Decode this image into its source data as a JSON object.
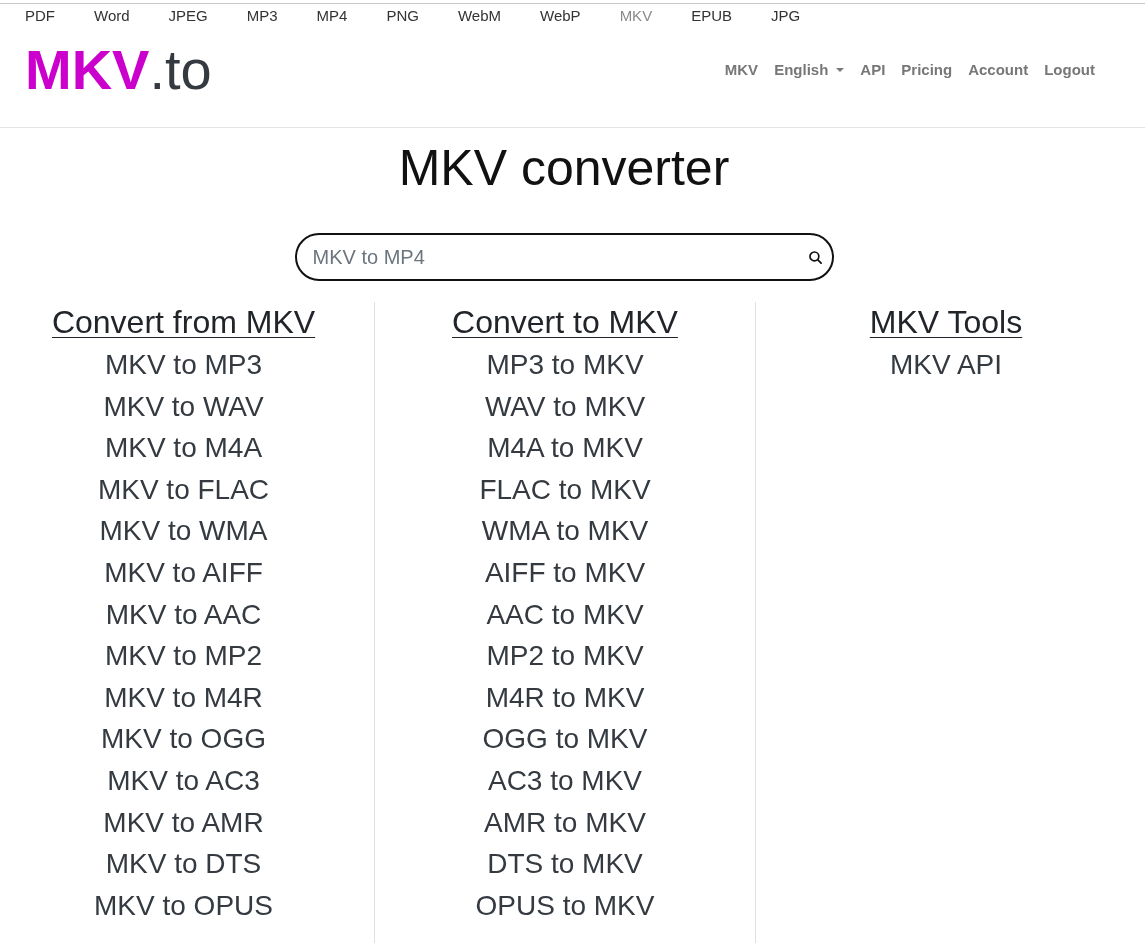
{
  "top_bar": {
    "links": [
      {
        "label": "PDF",
        "selected": false
      },
      {
        "label": "Word",
        "selected": false
      },
      {
        "label": "JPEG",
        "selected": false
      },
      {
        "label": "MP3",
        "selected": false
      },
      {
        "label": "MP4",
        "selected": false
      },
      {
        "label": "PNG",
        "selected": false
      },
      {
        "label": "WebM",
        "selected": false
      },
      {
        "label": "WebP",
        "selected": false
      },
      {
        "label": "MKV",
        "selected": true
      },
      {
        "label": "EPUB",
        "selected": false
      },
      {
        "label": "JPG",
        "selected": false
      }
    ]
  },
  "header": {
    "logo": {
      "brand": "MKV",
      "suffix": ".to"
    },
    "nav": [
      {
        "label": "MKV",
        "kind": "link"
      },
      {
        "label": "English",
        "kind": "dropdown"
      },
      {
        "label": "API",
        "kind": "link"
      },
      {
        "label": "Pricing",
        "kind": "link"
      },
      {
        "label": "Account",
        "kind": "link"
      },
      {
        "label": "Logout",
        "kind": "link"
      }
    ]
  },
  "title": "MKV converter",
  "search": {
    "placeholder": "MKV to MP4"
  },
  "columns": [
    {
      "heading": "Convert from MKV",
      "links": [
        "MKV to MP3",
        "MKV to WAV",
        "MKV to M4A",
        "MKV to FLAC",
        "MKV to WMA",
        "MKV to AIFF",
        "MKV to AAC",
        "MKV to MP2",
        "MKV to M4R",
        "MKV to OGG",
        "MKV to AC3",
        "MKV to AMR",
        "MKV to DTS",
        "MKV to OPUS"
      ]
    },
    {
      "heading": "Convert to MKV",
      "links": [
        "MP3 to MKV",
        "WAV to MKV",
        "M4A to MKV",
        "FLAC to MKV",
        "WMA to MKV",
        "AIFF to MKV",
        "AAC to MKV",
        "MP2 to MKV",
        "M4R to MKV",
        "OGG to MKV",
        "AC3 to MKV",
        "AMR to MKV",
        "DTS to MKV",
        "OPUS to MKV"
      ]
    },
    {
      "heading": "MKV Tools",
      "links": [
        "MKV API"
      ]
    }
  ]
}
